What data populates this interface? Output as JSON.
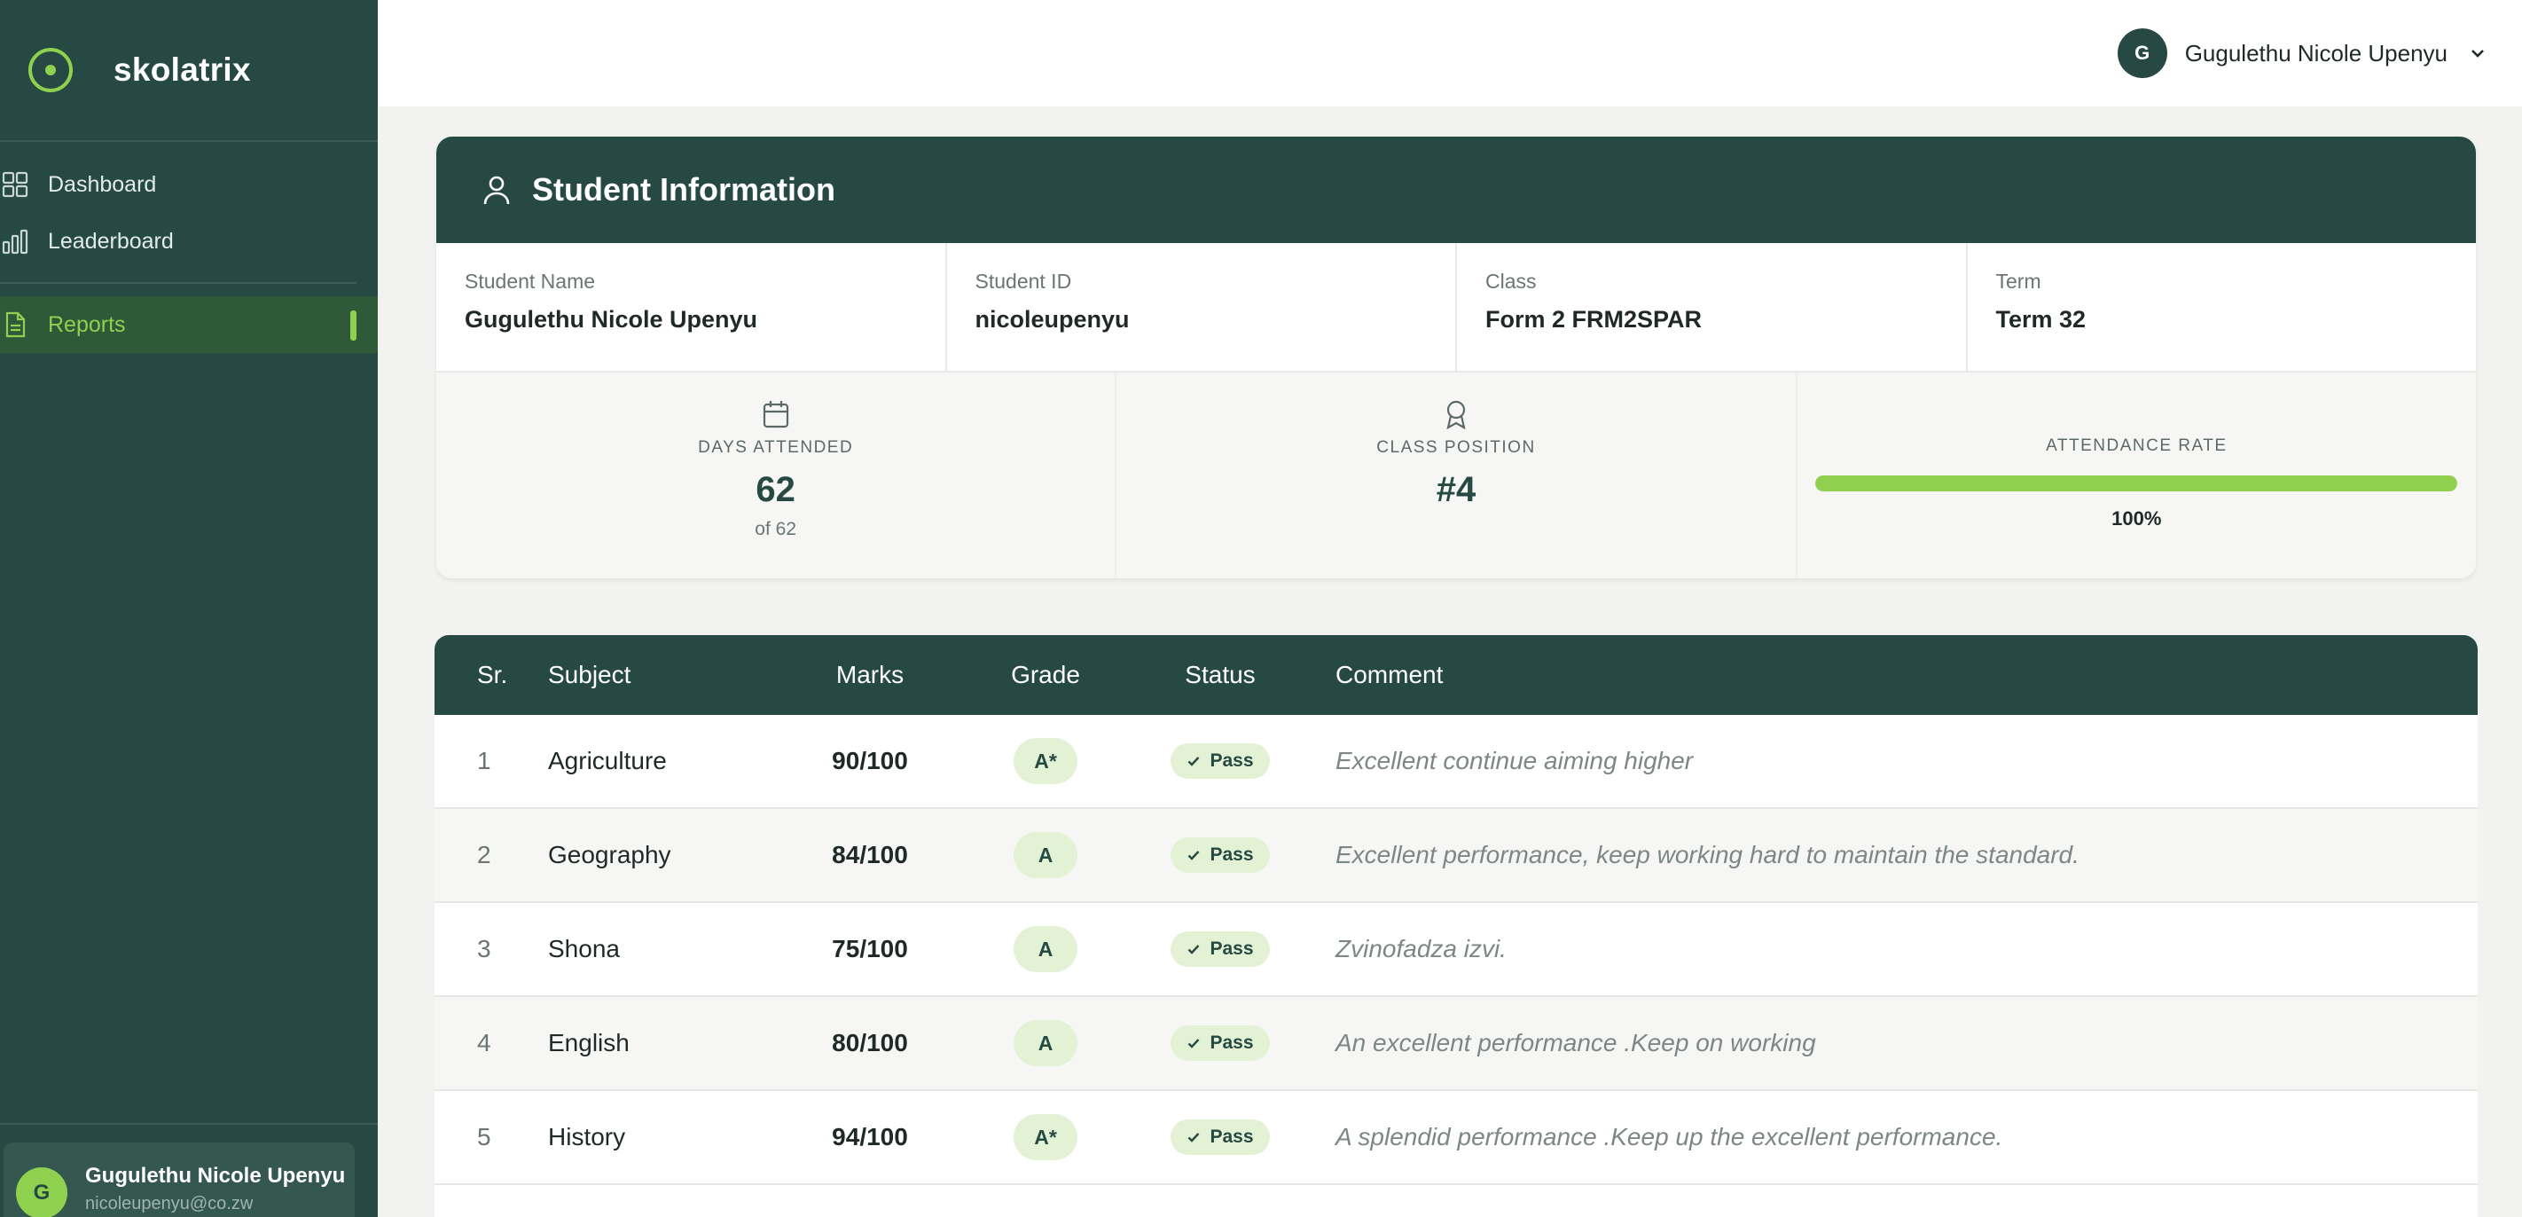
{
  "app": {
    "name": "skolatrix"
  },
  "sidebar": {
    "items": [
      {
        "label": "Dashboard",
        "icon": "grid-icon",
        "active": false
      },
      {
        "label": "Leaderboard",
        "icon": "bar-chart-icon",
        "active": false
      },
      {
        "label": "Reports",
        "icon": "document-icon",
        "active": true
      }
    ],
    "user": {
      "initial": "G",
      "name": "Gugulethu Nicole Upenyu",
      "email": "nicoleupenyu@co.zw"
    }
  },
  "topbar": {
    "user_initial": "G",
    "user_name": "Gugulethu Nicole Upenyu"
  },
  "student_info": {
    "title": "Student Information",
    "fields": [
      {
        "label": "Student Name",
        "value": "Gugulethu Nicole Upenyu"
      },
      {
        "label": "Student ID",
        "value": "nicoleupenyu"
      },
      {
        "label": "Class",
        "value": "Form 2 FRM2SPAR"
      },
      {
        "label": "Term",
        "value": "Term 32"
      }
    ],
    "stats": {
      "days_attended": {
        "label": "DAYS ATTENDED",
        "value": "62",
        "sub": "of 62"
      },
      "class_position": {
        "label": "CLASS POSITION",
        "value": "#4"
      },
      "attendance_rate": {
        "label": "ATTENDANCE RATE",
        "value": "100%",
        "fraction": 1.0
      }
    }
  },
  "results": {
    "headers": {
      "sr": "Sr.",
      "subject": "Subject",
      "marks": "Marks",
      "grade": "Grade",
      "status": "Status",
      "comment": "Comment"
    },
    "rows": [
      {
        "sr": "1",
        "subject": "Agriculture",
        "marks": "90/100",
        "grade": "A*",
        "status": "Pass",
        "comment": "Excellent continue aiming higher"
      },
      {
        "sr": "2",
        "subject": "Geography",
        "marks": "84/100",
        "grade": "A",
        "status": "Pass",
        "comment": "Excellent performance, keep working hard to maintain the standard."
      },
      {
        "sr": "3",
        "subject": "Shona",
        "marks": "75/100",
        "grade": "A",
        "status": "Pass",
        "comment": "Zvinofadza izvi."
      },
      {
        "sr": "4",
        "subject": "English",
        "marks": "80/100",
        "grade": "A",
        "status": "Pass",
        "comment": "An excellent performance .Keep on working"
      },
      {
        "sr": "5",
        "subject": "History",
        "marks": "94/100",
        "grade": "A*",
        "status": "Pass",
        "comment": "A splendid performance .Keep up the excellent performance."
      }
    ]
  },
  "colors": {
    "primary": "#264a43",
    "accent": "#8fd14f",
    "background": "#f2f3f1"
  }
}
